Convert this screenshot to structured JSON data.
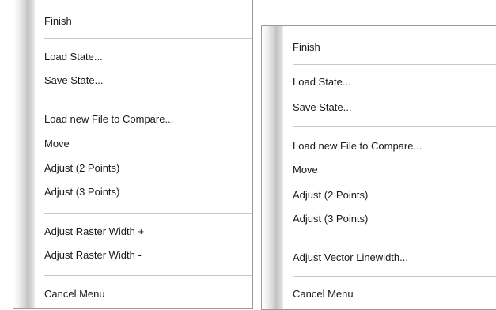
{
  "left_menu": {
    "items": [
      "Finish",
      "Load State...",
      "Save State...",
      "Load new File to Compare...",
      "Move",
      "Adjust (2 Points)",
      "Adjust (3 Points)",
      "Adjust Raster Width +",
      "Adjust Raster Width -",
      "Cancel Menu"
    ]
  },
  "right_menu": {
    "items": [
      "Finish",
      "Load State...",
      "Save State...",
      "Load new File to Compare...",
      "Move",
      "Adjust (2 Points)",
      "Adjust (3 Points)",
      "Adjust Vector Linewidth...",
      "Cancel Menu"
    ]
  }
}
